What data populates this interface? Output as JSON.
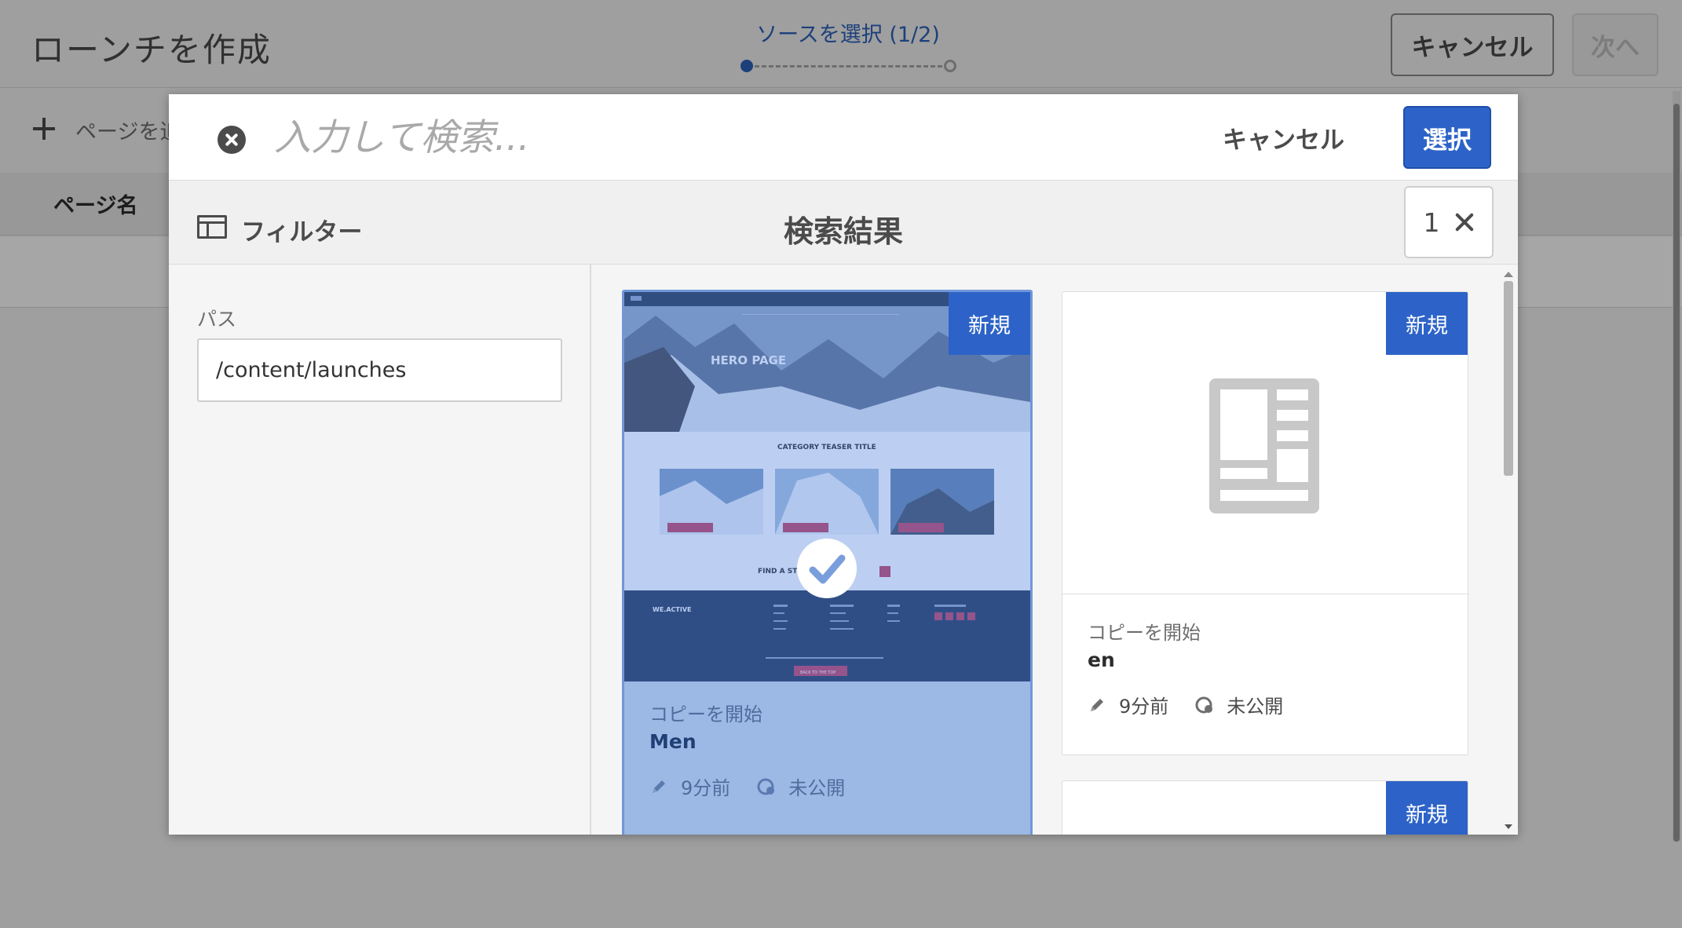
{
  "page": {
    "title": "ローンチを作成",
    "wizard_step": "ソースを選択 (1/2)",
    "cancel_label": "キャンセル",
    "next_label": "次へ",
    "add_pages_label": "ページを追加",
    "column_page_name": "ページ名"
  },
  "dialog": {
    "search_placeholder": "入力して検索...",
    "cancel_label": "キャンセル",
    "select_label": "選択",
    "filter_label": "フィルター",
    "results_title": "検索結果",
    "selection_count": "1",
    "path_label": "パス",
    "path_value": "/content/launches",
    "accent_color": "#2d63c8"
  },
  "results": [
    {
      "badge": "新規",
      "meta_label": "コピーを開始",
      "name": "Men",
      "modified": "9分前",
      "status": "未公開",
      "selected": true,
      "thumbnail": {
        "hero_text": "HERO PAGE",
        "section_title": "CATEGORY TEASER TITLE",
        "find_text": "FIND A STORE",
        "brand": "WE.ACTIVE",
        "footer_button": "BACK TO THE TOP"
      }
    },
    {
      "badge": "新規",
      "meta_label": "コピーを開始",
      "name": "en",
      "modified": "9分前",
      "status": "未公開",
      "selected": false,
      "icon": "document-page-icon"
    },
    {
      "badge": "新規",
      "selected": false
    }
  ]
}
